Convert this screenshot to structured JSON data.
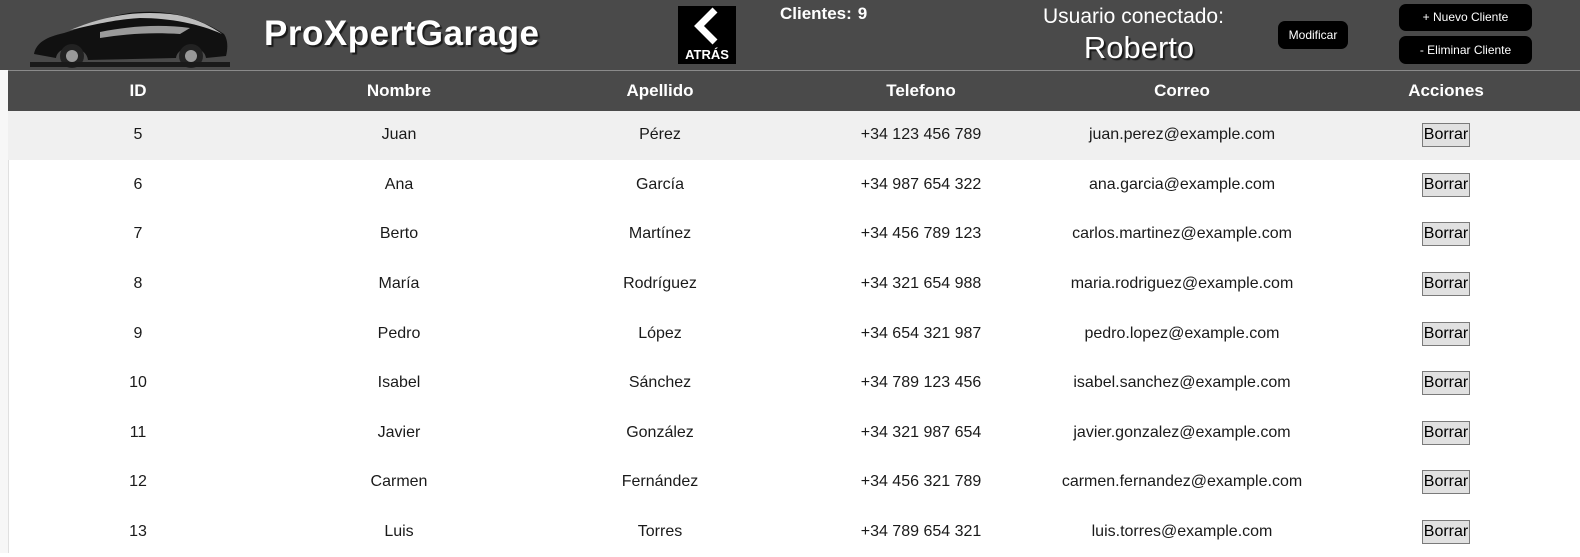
{
  "header": {
    "app_title": "ProXpertGarage",
    "back_label": "ATRÁS",
    "clients_label": "Clientes:",
    "clients_count": "9",
    "user_label": "Usuario conectado:",
    "user_name": "Roberto",
    "modify_label": "Modificar",
    "new_client_label": "+ Nuevo Cliente",
    "delete_client_label": "- Eliminar Cliente"
  },
  "table": {
    "columns": [
      "ID",
      "Nombre",
      "Apellido",
      "Telefono",
      "Correo",
      "Acciones"
    ],
    "action_label": "Borrar",
    "rows": [
      {
        "id": "5",
        "nombre": "Juan",
        "apellido": "Pérez",
        "telefono": "+34 123 456 789",
        "correo": "juan.perez@example.com"
      },
      {
        "id": "6",
        "nombre": "Ana",
        "apellido": "García",
        "telefono": "+34 987 654 322",
        "correo": "ana.garcia@example.com"
      },
      {
        "id": "7",
        "nombre": "Berto",
        "apellido": "Martínez",
        "telefono": "+34 456 789 123",
        "correo": "carlos.martinez@example.com"
      },
      {
        "id": "8",
        "nombre": "María",
        "apellido": "Rodríguez",
        "telefono": "+34 321 654 988",
        "correo": "maria.rodriguez@example.com"
      },
      {
        "id": "9",
        "nombre": "Pedro",
        "apellido": "López",
        "telefono": "+34 654 321 987",
        "correo": "pedro.lopez@example.com"
      },
      {
        "id": "10",
        "nombre": "Isabel",
        "apellido": "Sánchez",
        "telefono": "+34 789 123 456",
        "correo": "isabel.sanchez@example.com"
      },
      {
        "id": "11",
        "nombre": "Javier",
        "apellido": "González",
        "telefono": "+34 321 987 654",
        "correo": "javier.gonzalez@example.com"
      },
      {
        "id": "12",
        "nombre": "Carmen",
        "apellido": "Fernández",
        "telefono": "+34 456 321 789",
        "correo": "carmen.fernandez@example.com"
      },
      {
        "id": "13",
        "nombre": "Luis",
        "apellido": "Torres",
        "telefono": "+34 789 654 321",
        "correo": "luis.torres@example.com"
      }
    ]
  },
  "icons": {
    "logo": "car-logo-icon",
    "back": "chevron-left-icon"
  },
  "colors": {
    "header_bg": "#4a4a4a",
    "button_bg": "#000000",
    "highlight_row": "#f0f0f0"
  }
}
